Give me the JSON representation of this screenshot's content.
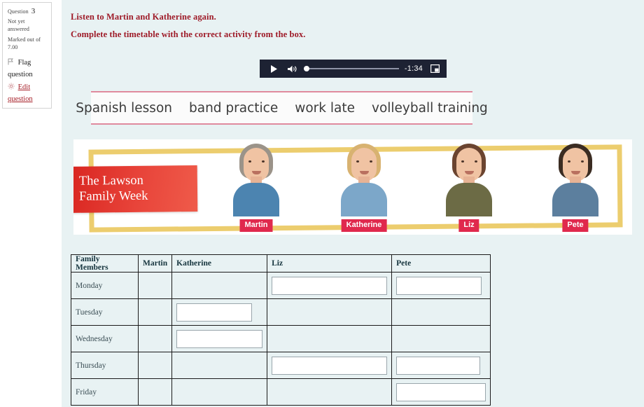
{
  "question_info": {
    "question_label": "Question",
    "question_number": "3",
    "status": "Not yet answered",
    "marked_out_of_label": "Marked out of",
    "marked_out_of_value": "7.00",
    "flag_label": "Flag question",
    "flag_icon": "flag-icon",
    "edit_label": "Edit question",
    "edit_icon": "gear-icon",
    "link_color": "#a51d26"
  },
  "instructions": [
    "Listen to Martin and Katherine again.",
    "Complete the timetable with the correct activity from the box."
  ],
  "audio_player": {
    "play_icon": "play-icon",
    "volume_icon": "volume-icon",
    "time_remaining": "-1:34",
    "pip_icon": "picture-in-picture-icon",
    "progress_percent": 0,
    "background_color": "#1d2233"
  },
  "word_box": {
    "border_color": "#e08a9e",
    "words": [
      "Spanish lesson",
      "band practice",
      "work late",
      "volleyball training"
    ]
  },
  "banner": {
    "title_line1": "The Lawson",
    "title_line2": "Family Week",
    "title_bg_color": "#e0342b",
    "frame_color": "#eccd6e",
    "name_tag_color": "#e0294d",
    "people": [
      {
        "name": "Martin",
        "hair_color": "#9b9389",
        "shirt_color": "#4c84b0"
      },
      {
        "name": "Katherine",
        "hair_color": "#d8b271",
        "shirt_color": "#7ca7c9"
      },
      {
        "name": "Liz",
        "hair_color": "#6b4430",
        "shirt_color": "#6c6b45"
      },
      {
        "name": "Pete",
        "hair_color": "#3b2c22",
        "shirt_color": "#5c7f9e"
      }
    ]
  },
  "timetable": {
    "headers": [
      "Family Members",
      "Martin",
      "Katherine",
      "Liz",
      "Pete"
    ],
    "rows": [
      {
        "day": "Monday",
        "cells": [
          {
            "type": "empty"
          },
          {
            "type": "empty"
          },
          {
            "type": "input",
            "value": "",
            "width": "w-full"
          },
          {
            "type": "input",
            "value": "",
            "width": "w-pet1"
          }
        ]
      },
      {
        "day": "Tuesday",
        "cells": [
          {
            "type": "empty"
          },
          {
            "type": "input",
            "value": "",
            "width": "w-kat1"
          },
          {
            "type": "empty"
          },
          {
            "type": "empty"
          }
        ]
      },
      {
        "day": "Wednesday",
        "cells": [
          {
            "type": "empty"
          },
          {
            "type": "input",
            "value": "",
            "width": "w-kat2"
          },
          {
            "type": "empty"
          },
          {
            "type": "empty"
          }
        ]
      },
      {
        "day": "Thursday",
        "cells": [
          {
            "type": "empty"
          },
          {
            "type": "empty"
          },
          {
            "type": "input",
            "value": "",
            "width": "w-full"
          },
          {
            "type": "input",
            "value": "",
            "width": "w-pet2"
          }
        ]
      },
      {
        "day": "Friday",
        "cells": [
          {
            "type": "empty"
          },
          {
            "type": "empty"
          },
          {
            "type": "empty"
          },
          {
            "type": "input",
            "value": "",
            "width": "w-pet3"
          }
        ]
      }
    ]
  }
}
